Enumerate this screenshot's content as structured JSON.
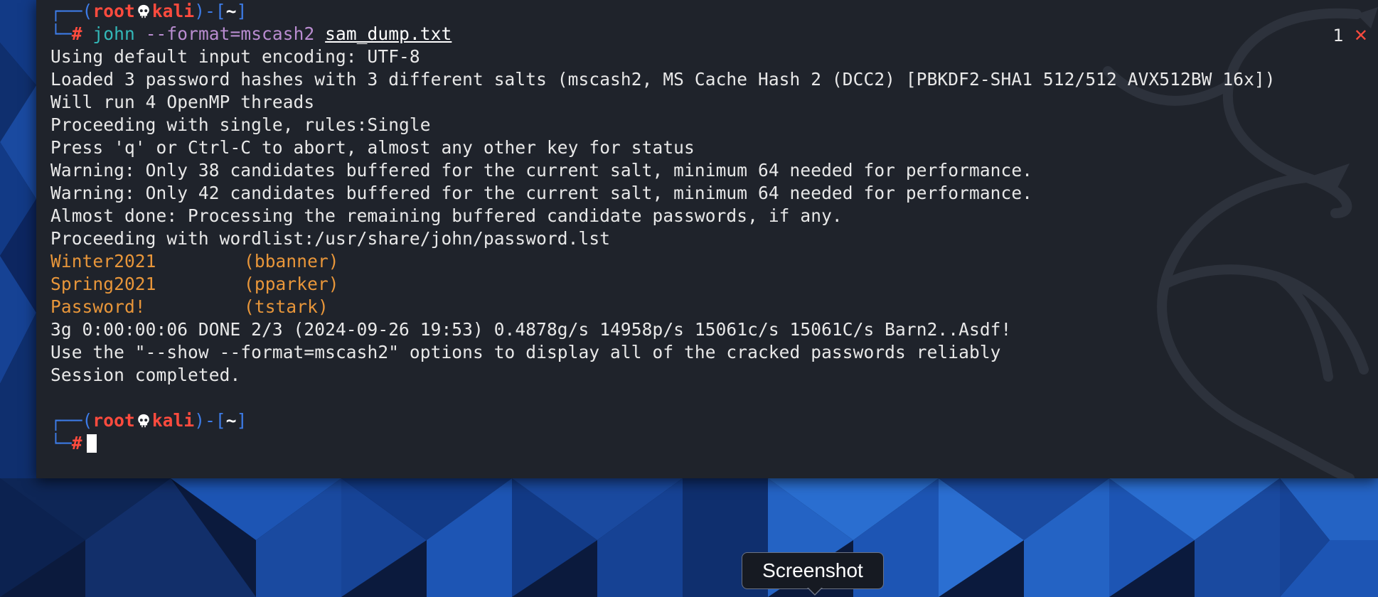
{
  "prompt": {
    "frame_top_open": "┌──(",
    "frame_top_close": ")-[",
    "user": "root",
    "host": "kali",
    "dir": "~",
    "dir_close": "]",
    "frame_bottom": "└─",
    "hash": "#"
  },
  "command": {
    "name": "john",
    "arg": "--format=mscash2",
    "file": "sam_dump.txt"
  },
  "tab_indicator": {
    "count": "1",
    "close_glyph": "✕"
  },
  "output_lines": [
    "Using default input encoding: UTF-8",
    "Loaded 3 password hashes with 3 different salts (mscash2, MS Cache Hash 2 (DCC2) [PBKDF2-SHA1 512/512 AVX512BW 16x])",
    "Will run 4 OpenMP threads",
    "Proceeding with single, rules:Single",
    "Press 'q' or Ctrl-C to abort, almost any other key for status",
    "Warning: Only 38 candidates buffered for the current salt, minimum 64 needed for performance.",
    "Warning: Only 42 candidates buffered for the current salt, minimum 64 needed for performance.",
    "Almost done: Processing the remaining buffered candidate passwords, if any.",
    "Proceeding with wordlist:/usr/share/john/password.lst"
  ],
  "cracked": [
    {
      "password": "Winter2021",
      "user": "(bbanner)"
    },
    {
      "password": "Spring2021",
      "user": "(pparker)"
    },
    {
      "password": "Password!",
      "user": "(tstark)"
    }
  ],
  "summary_lines": [
    "3g 0:00:00:06 DONE 2/3 (2024-09-26 19:53) 0.4878g/s 14958p/s 15061c/s 15061C/s Barn2..Asdf!",
    "Use the \"--show --format=mscash2\" options to display all of the cracked passwords reliably",
    "Session completed."
  ],
  "tooltip": {
    "label": "Screenshot"
  },
  "colors": {
    "terminal_bg": "#1f232b",
    "prompt_red": "#ff4b3e",
    "prompt_blue": "#3d7ce8",
    "cracked_orange": "#e8963a",
    "cmd_cyan": "#33b8b8",
    "cmd_purple": "#b98cd0"
  },
  "icons": {
    "skull": "skull-icon",
    "dragon": "kali-dragon-watermark"
  }
}
